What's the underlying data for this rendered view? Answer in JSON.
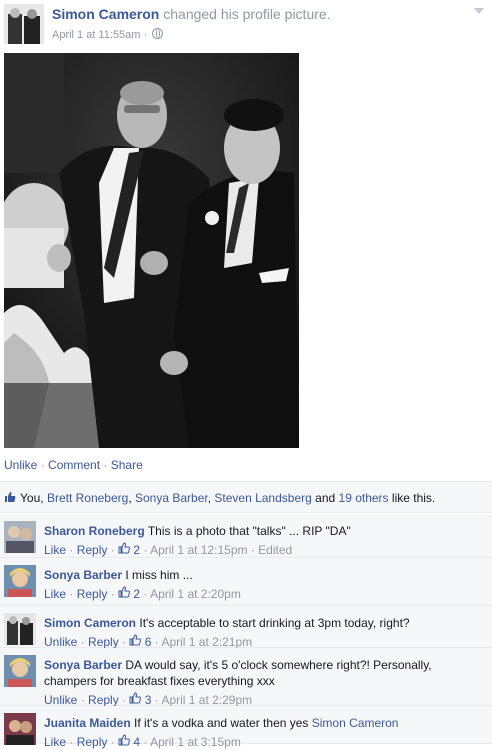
{
  "post": {
    "author": "Simon Cameron",
    "action": "changed his profile picture.",
    "timestamp": "April 1 at 11:55am",
    "audience_icon": "globe-icon",
    "menu_icon": "chevron-down-icon"
  },
  "actions": {
    "unlike": "Unlike",
    "comment": "Comment",
    "share": "Share"
  },
  "likes": {
    "you": "You,",
    "names": [
      "Brett Roneberg",
      "Sonya Barber",
      "Steven Landsberg"
    ],
    "and": "and",
    "others": "19 others",
    "suffix": "like this."
  },
  "comments": [
    {
      "name": "Sharon Roneberg",
      "text": "This is a photo that \"talks\" ... RIP \"DA\"",
      "action": "Like",
      "reply": "Reply",
      "likes": "2",
      "time": "April 1 at 12:15pm",
      "edited": "Edited"
    },
    {
      "name": "Sonya Barber",
      "text": "I miss him ...",
      "action": "Like",
      "reply": "Reply",
      "likes": "2",
      "time": "April 1 at 2:20pm"
    },
    {
      "name": "Simon Cameron",
      "text": "It's acceptable to start drinking at 3pm today, right?",
      "action": "Unlike",
      "reply": "Reply",
      "likes": "6",
      "time": "April 1 at 2:21pm"
    },
    {
      "name": "Sonya Barber",
      "text": "DA would say, it's 5 o'clock somewhere right?! Personally, champers for breakfast fixes everything xxx",
      "action": "Unlike",
      "reply": "Reply",
      "likes": "3",
      "time": "April 1 at 2:29pm"
    },
    {
      "name": "Juanita Maiden",
      "text": "If it's a vodka and water then yes",
      "mention": "Simon Cameron",
      "action": "Like",
      "reply": "Reply",
      "likes": "4",
      "time": "April 1 at 3:15pm"
    }
  ],
  "colors": {
    "link": "#3b5998",
    "meta": "#9197a3",
    "panel": "#f6f7f9"
  }
}
